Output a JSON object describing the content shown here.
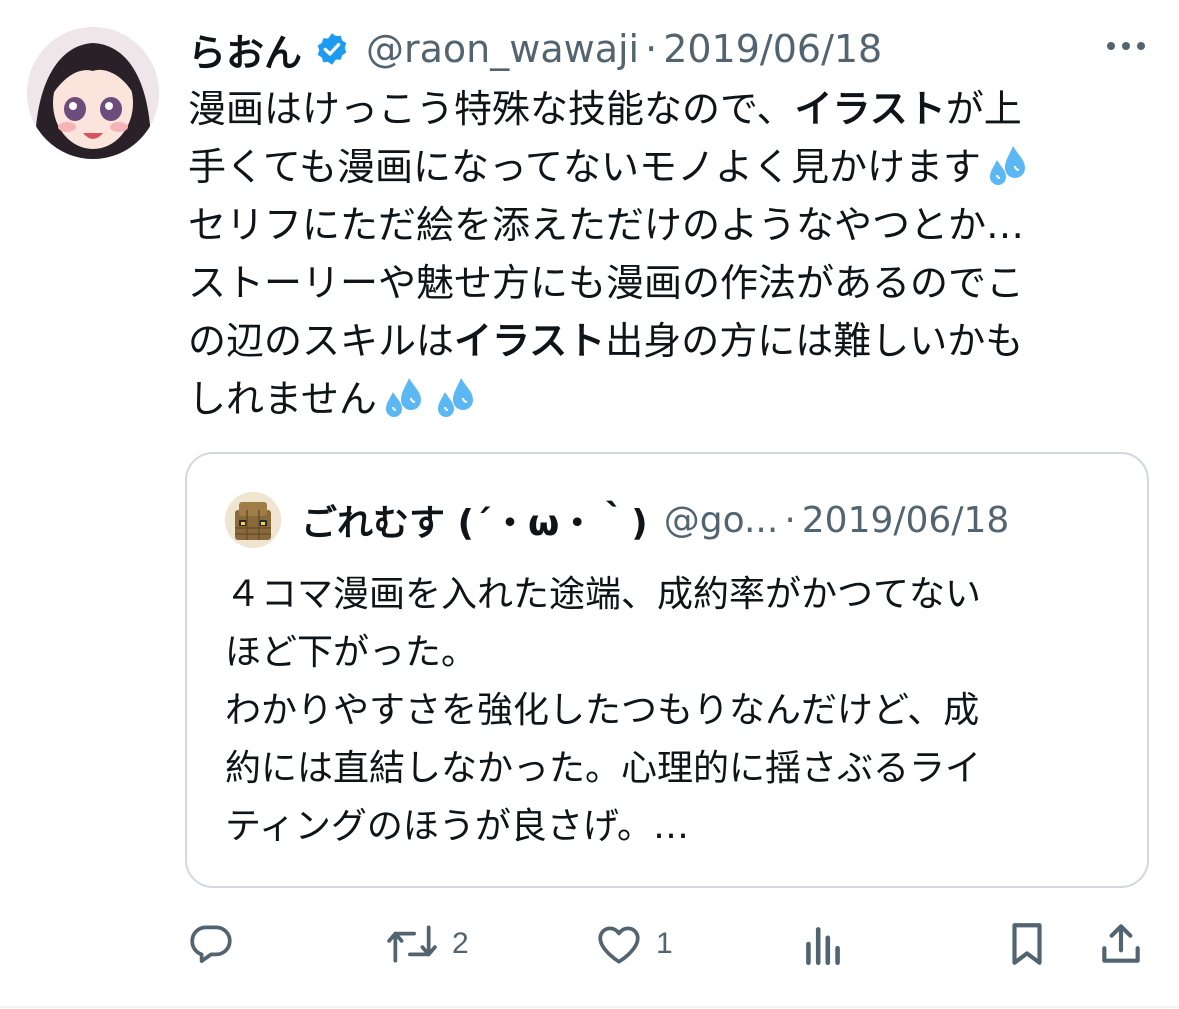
{
  "tweet": {
    "display_name": "らおん",
    "handle": "@raon_wawaji",
    "separator": "·",
    "date": "2019/06/18",
    "body": {
      "l1a": "漫画はけっこう特殊な技能なので、",
      "l1b": "イラスト",
      "l1c": "が上",
      "l2": "手くても漫画になってないモノよく見かけます",
      "l3": "セリフにただ絵を添えただけのようなやつとか…",
      "l4": "ストーリーや魅せ方にも漫画の作法があるのでこ",
      "l5a": "の辺のスキルは",
      "l5b": "イラスト",
      "l5c": "出身の方には難しいかも",
      "l6": "しれません"
    },
    "emoji": "sweat-droplets-emoji"
  },
  "quote": {
    "display_name": "ごれむす (´・ω・｀)",
    "handle": "@go...",
    "separator": "·",
    "date": "2019/06/18",
    "lines": [
      "４コマ漫画を入れた途端、成約率がかつてない",
      "ほど下がった。",
      "わかりやすさを強化したつもりなんだけど、成",
      "約には直結しなかった。心理的に揺さぶるライ",
      "ティングのほうが良さげ。…"
    ]
  },
  "actions": {
    "reply_icon": "reply-icon",
    "retweet_icon": "retweet-icon",
    "retweet_count": "2",
    "like_icon": "heart-icon",
    "like_count": "1",
    "views_icon": "bar-chart-icon",
    "bookmark_icon": "bookmark-icon",
    "share_icon": "share-icon"
  },
  "colors": {
    "text": "#0f1419",
    "secondary": "#536471",
    "verified": "#1d9bf0",
    "border": "#cfd9de"
  }
}
